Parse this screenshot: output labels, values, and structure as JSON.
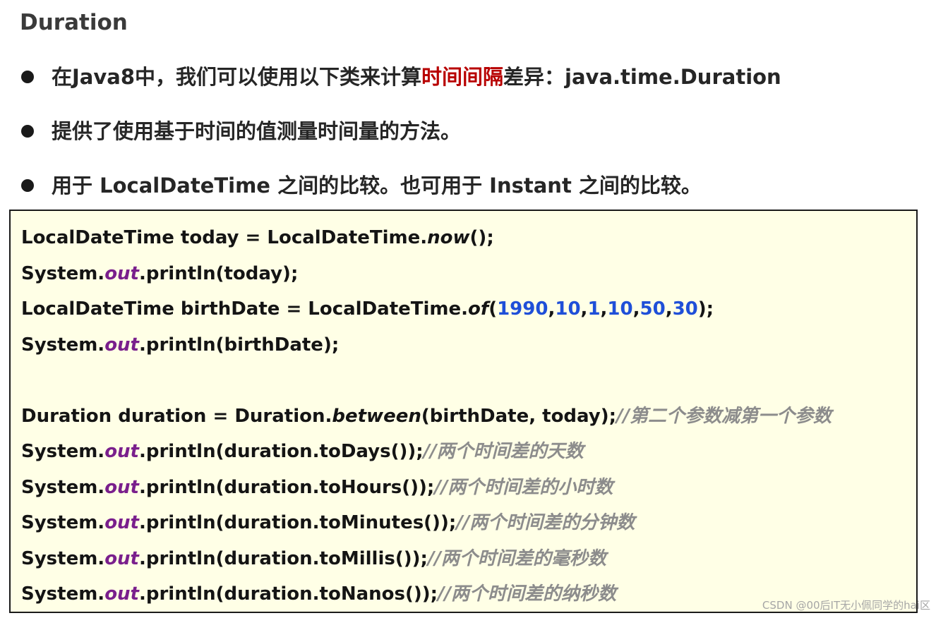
{
  "title": "Duration",
  "bullets": [
    {
      "before": "在Java8中，我们可以使用以下类来计算",
      "highlight": "时间间隔",
      "after": "差异：java.time.Duration"
    },
    {
      "text": "提供了使用基于时间的值测量时间量的方法。"
    },
    {
      "text": "用于 LocalDateTime 之间的比较。也可用于 Instant 之间的比较。"
    }
  ],
  "code": {
    "l1": {
      "a": "LocalDateTime today = LocalDateTime.",
      "method": "now",
      "b": "();"
    },
    "l2": {
      "a": "System.",
      "field": "out",
      "b": ".println(today);"
    },
    "l3": {
      "a": "LocalDateTime birthDate = LocalDateTime.",
      "method": "of",
      "open": "(",
      "args": [
        "1990",
        "10",
        "1",
        "10",
        "50",
        "30"
      ],
      "sep": ",",
      "close": ");"
    },
    "l4": {
      "a": "System.",
      "field": "out",
      "b": ".println(birthDate);"
    },
    "l6": {
      "a": "Duration duration = Duration.",
      "method": "between",
      "b": "(birthDate, today);",
      "comment": "//第二个参数减第一个参数"
    },
    "l7": {
      "a": "System.",
      "field": "out",
      "b": ".println(duration.toDays());",
      "comment": "//两个时间差的天数"
    },
    "l8": {
      "a": "System.",
      "field": "out",
      "b": ".println(duration.toHours());",
      "comment": "//两个时间差的小时数"
    },
    "l9": {
      "a": "System.",
      "field": "out",
      "b": ".println(duration.toMinutes());",
      "comment": "//两个时间差的分钟数"
    },
    "l10": {
      "a": "System.",
      "field": "out",
      "b": ".println(duration.toMillis());",
      "comment": "//两个时间差的毫秒数"
    },
    "l11": {
      "a": "System.",
      "field": "out",
      "b": ".println(duration.toNanos());",
      "comment": "//两个时间差的纳秒数"
    }
  },
  "watermark": "CSDN @00后IT无小佩同学的hai区"
}
